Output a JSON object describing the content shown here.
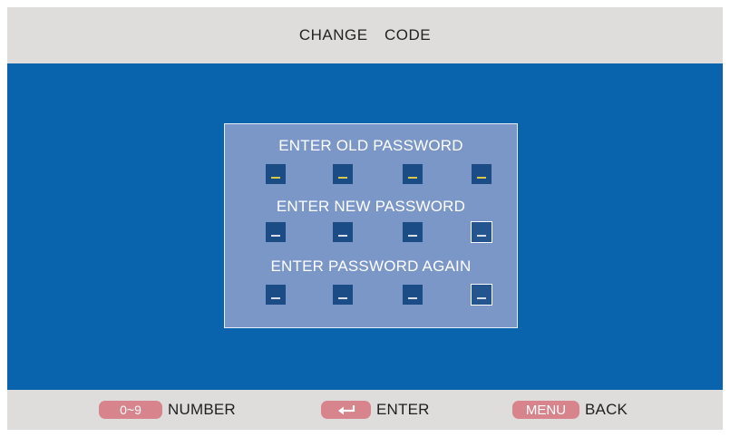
{
  "header": {
    "title": "CHANGE  CODE"
  },
  "panel": {
    "fields": [
      {
        "label": "ENTER OLD PASSWORD",
        "slots": [
          "_",
          "_",
          "_",
          "_"
        ]
      },
      {
        "label": "ENTER NEW PASSWORD",
        "slots": [
          "_",
          "_",
          "_",
          "_"
        ]
      },
      {
        "label": "ENTER PASSWORD AGAIN",
        "slots": [
          "_",
          "_",
          "_",
          "_"
        ]
      }
    ]
  },
  "footer": {
    "number_key": "0~9",
    "number_label": "NUMBER",
    "enter_icon": "return-arrow-icon",
    "enter_label": "ENTER",
    "menu_key": "MENU",
    "menu_label": "BACK"
  },
  "colors": {
    "background": "#0a64ad",
    "bars": "#dfdcdc",
    "panel": "#7b97c8",
    "slot": "#1b4c86",
    "key": "#d7848c",
    "old_password_dash": "#d8c84a"
  }
}
